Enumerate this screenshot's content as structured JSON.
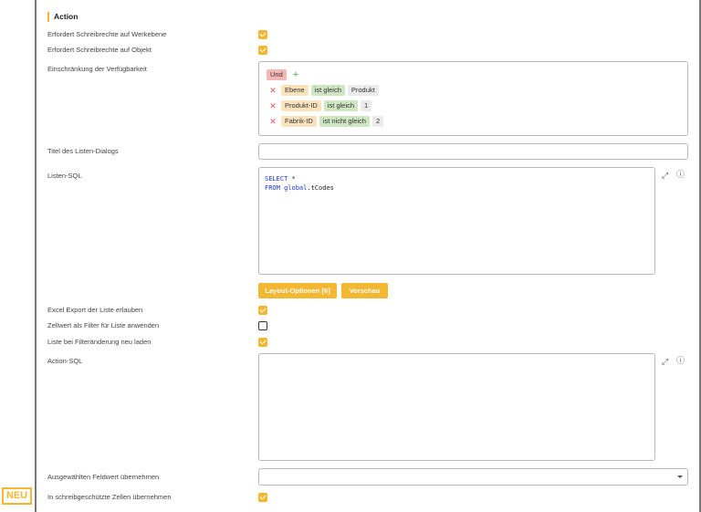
{
  "section": {
    "title": "Action"
  },
  "fields": {
    "require_write_level": {
      "label": "Erfordert Schreibrechte auf Werkebene",
      "checked": true
    },
    "require_write_object": {
      "label": "Erfordert Schreibrechte auf Objekt",
      "checked": true
    },
    "availability": {
      "label": "Einschränkung der Verfügbarkeit",
      "operator": "Und",
      "conditions": [
        {
          "field": "Ebene",
          "op": "ist gleich",
          "value": "Produkt"
        },
        {
          "field": "Produkt-ID",
          "op": "ist gleich",
          "value": "1"
        },
        {
          "field": "Fabrik-ID",
          "op": "ist nicht gleich",
          "value": "2"
        }
      ]
    },
    "list_dialog_title": {
      "label": "Titel des Listen-Dialogs",
      "value": ""
    },
    "list_sql": {
      "label": "Listen-SQL",
      "line1_kw": "SELECT",
      "line1_rest": " *",
      "line2_kw": "FROM",
      "line2_schema": "global",
      "line2_rest": ".tCodes"
    },
    "buttons": {
      "layout_options": "Layout-Optionen [6]",
      "preview": "Vorschau"
    },
    "excel_export": {
      "label": "Excel Export der Liste erlauben",
      "checked": true
    },
    "cell_filter": {
      "label": "Zellwert als Filter für Liste anwenden",
      "checked": false
    },
    "reload_on_filter": {
      "label": "Liste bei Filteränderung neu laden",
      "checked": true
    },
    "action_sql": {
      "label": "Action-SQL",
      "value": ""
    },
    "apply_field_value": {
      "label": "Ausgewählten Feldwert übernehmen",
      "value": ""
    },
    "apply_readonly": {
      "label": "In schreibgeschützte Zellen übernehmen",
      "checked": true
    }
  },
  "badge": {
    "text": "NEU"
  },
  "icons": {
    "expand": "expand-icon",
    "info": "info-icon",
    "remove": "close-icon",
    "add": "plus-icon"
  },
  "colors": {
    "accent": "#f4b731",
    "und_tag": "#f5b6b6",
    "field_tag": "#fbe3bd",
    "op_tag": "#cfe6c3",
    "value_tag": "#ebebeb"
  }
}
